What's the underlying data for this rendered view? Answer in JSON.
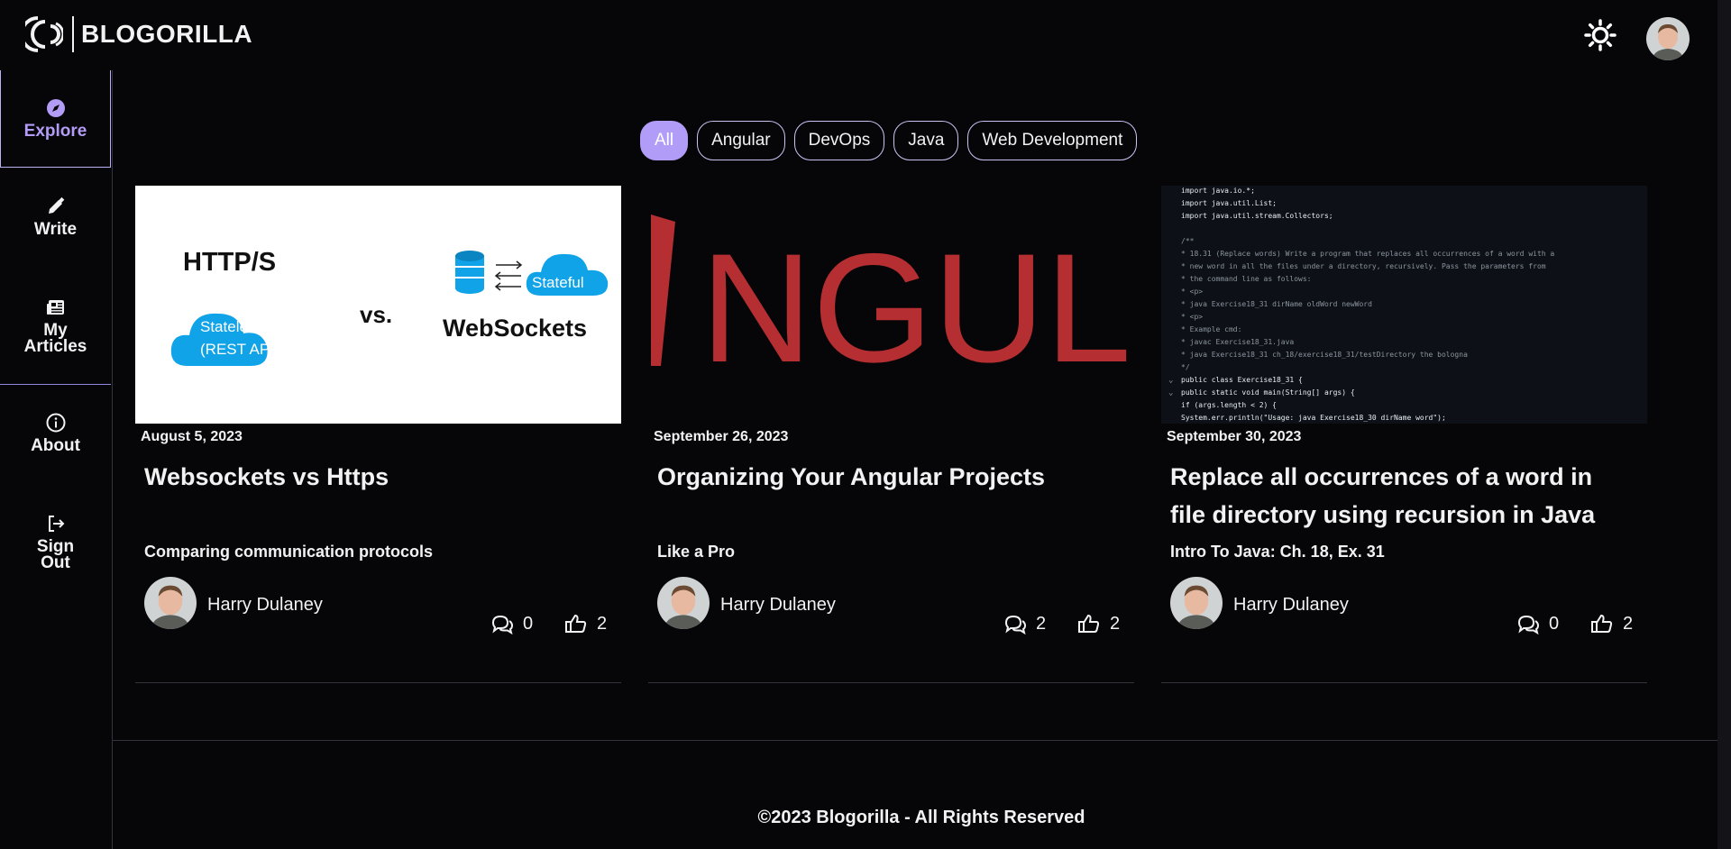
{
  "header": {
    "brand": "BLOGORILLA",
    "theme_icon": "sun-icon",
    "avatar_icon": "user-avatar"
  },
  "sidebar": {
    "items": [
      {
        "label": "Explore",
        "icon": "compass-icon",
        "active": true
      },
      {
        "label": "Write",
        "icon": "pencil-icon"
      },
      {
        "label": "My Articles",
        "icon": "newspaper-icon"
      },
      {
        "label": "About",
        "icon": "info-icon"
      },
      {
        "label": "Sign Out",
        "icon": "sign-out-icon"
      }
    ]
  },
  "filters": [
    {
      "label": "All",
      "active": true
    },
    {
      "label": "Angular"
    },
    {
      "label": "DevOps"
    },
    {
      "label": "Java"
    },
    {
      "label": "Web Development"
    }
  ],
  "colors": {
    "accent": "#b19df7",
    "background": "#060608",
    "angular_red": "#b52e31",
    "cloud_blue": "#11a3e8"
  },
  "cards": [
    {
      "image": {
        "http_label": "HTTP/S",
        "vs_label": "vs.",
        "stateless_label_1": "Stateless",
        "stateless_label_2": "(REST API)",
        "stateful_label": "Stateful",
        "websockets_label": "WebSockets"
      },
      "date": "August 5, 2023",
      "title": "Websockets vs Https",
      "subtitle": "Comparing communication protocols",
      "author": "Harry Dulaney",
      "comments": "0",
      "likes": "2"
    },
    {
      "image": {
        "wordmark": "NGUL"
      },
      "date": "September 26, 2023",
      "title": "Organizing Your Angular Projects",
      "subtitle": "Like a Pro",
      "author": "Harry Dulaney",
      "comments": "2",
      "likes": "2"
    },
    {
      "image": {
        "code_lines": [
          "import java.io.*;",
          "import java.util.List;",
          "import java.util.stream.Collectors;",
          "",
          "/**",
          " * 18.31 (Replace words) Write a program that replaces all occurrences of a word with a",
          " * new word in all the files under a directory, recursively. Pass the parameters from",
          " * the command line as follows:",
          " * <p>",
          " * java Exercise18_31 dirName oldWord newWord",
          " * <p>",
          " * Example cmd:",
          " * javac Exercise18_31.java",
          " * java Exercise18_31 ch_18/exercise18_31/testDirectory the bologna",
          " */",
          "public class Exercise18_31 {",
          "    public static void main(String[] args) {",
          "        if (args.length < 2) {",
          "            System.err.println(\"Usage: java Exercise18_30 dirName word\");"
        ]
      },
      "date": "September 30, 2023",
      "title": "Replace all occurrences of a word in file directory using recursion in Java",
      "subtitle": "Intro To Java: Ch. 18, Ex. 31",
      "author": "Harry Dulaney",
      "comments": "0",
      "likes": "2"
    }
  ],
  "footer": {
    "text": "©2023 Blogorilla - All Rights Reserved"
  }
}
